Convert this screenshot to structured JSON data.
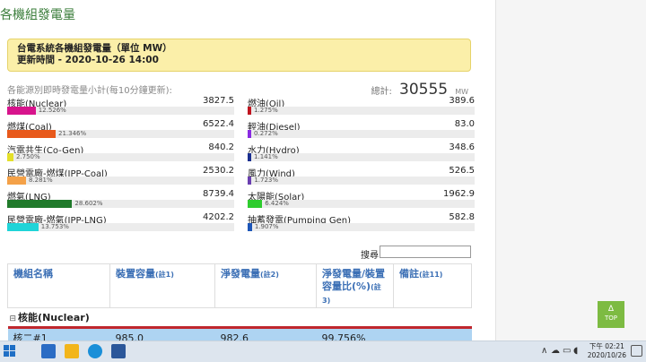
{
  "page": {
    "title": "各機組發電量"
  },
  "notice": {
    "line1": "台電系統各機組發電量（單位 MW）",
    "line2": "更新時間 - 2020-10-26 14:00"
  },
  "summary": {
    "label": "各能源別即時發電量小計(每10分鐘更新):",
    "total_label": "總計:",
    "total_value": "30555",
    "total_unit": "MW"
  },
  "sources_left": [
    {
      "name": "核能(Nuclear)",
      "value": "3827.5",
      "percent": "12.526%",
      "fraction": 0.12526,
      "color": "#d7148c"
    },
    {
      "name": "燃煤(Coal)",
      "value": "6522.4",
      "percent": "21.346%",
      "fraction": 0.21346,
      "color": "#e8591b"
    },
    {
      "name": "汽電共生(Co-Gen)",
      "value": "840.2",
      "percent": "2.750%",
      "fraction": 0.0275,
      "color": "#e4e02a"
    },
    {
      "name": "民營電廠-燃煤(IPP-Coal)",
      "value": "2530.2",
      "percent": "8.281%",
      "fraction": 0.08281,
      "color": "#f4a148"
    },
    {
      "name": "燃氣(LNG)",
      "value": "8739.4",
      "percent": "28.602%",
      "fraction": 0.28602,
      "color": "#207a2b"
    },
    {
      "name": "民營電廠-燃氣(IPP-LNG)",
      "value": "4202.2",
      "percent": "13.753%",
      "fraction": 0.13753,
      "color": "#20d4d8"
    }
  ],
  "sources_right": [
    {
      "name": "燃油(Oil)",
      "value": "389.6",
      "percent": "1.275%",
      "fraction": 0.01275,
      "color": "#c0141f"
    },
    {
      "name": "輕油(Diesel)",
      "value": "83.0",
      "percent": "0.272%",
      "fraction": 0.00272,
      "color": "#8a2be2"
    },
    {
      "name": "水力(Hydro)",
      "value": "348.6",
      "percent": "1.141%",
      "fraction": 0.01141,
      "color": "#1a2f8f"
    },
    {
      "name": "風力(Wind)",
      "value": "526.5",
      "percent": "1.723%",
      "fraction": 0.01723,
      "color": "#6a3fb0"
    },
    {
      "name": "太陽能(Solar)",
      "value": "1962.9",
      "percent": "6.424%",
      "fraction": 0.06424,
      "color": "#2ecc2e"
    },
    {
      "name": "抽蓄發電(Pumping Gen)",
      "value": "582.8",
      "percent": "1.907%",
      "fraction": 0.01907,
      "color": "#1d56b8"
    }
  ],
  "search": {
    "label": "搜尋",
    "placeholder": "",
    "value": ""
  },
  "table": {
    "headers": [
      {
        "text": "機組名稱",
        "note": ""
      },
      {
        "text": "裝置容量",
        "note": "(註1)"
      },
      {
        "text": "淨發電量",
        "note": "(註2)"
      },
      {
        "text": "淨發電量/裝置容量比(%)",
        "note": "(註3)"
      },
      {
        "text": "備註",
        "note": "(註11)"
      }
    ],
    "group": {
      "toggle": "⊟",
      "label": "核能(Nuclear)"
    },
    "rows": [
      {
        "name": "核二#1",
        "capacity": "985.0",
        "net": "982.6",
        "ratio": "99.756%",
        "remark": ""
      }
    ]
  },
  "top_button": {
    "arrow": "Δ",
    "label": "TOP"
  },
  "taskbar": {
    "tray_chevron": "∧",
    "clock_time": "下午 02:21",
    "clock_date": "2020/10/26",
    "colors": {
      "start": "#1f6fc5",
      "mail": "#2b6cc4",
      "explorer": "#f2b51b",
      "edge": "#1a8fd8",
      "word": "#2b579a"
    }
  }
}
